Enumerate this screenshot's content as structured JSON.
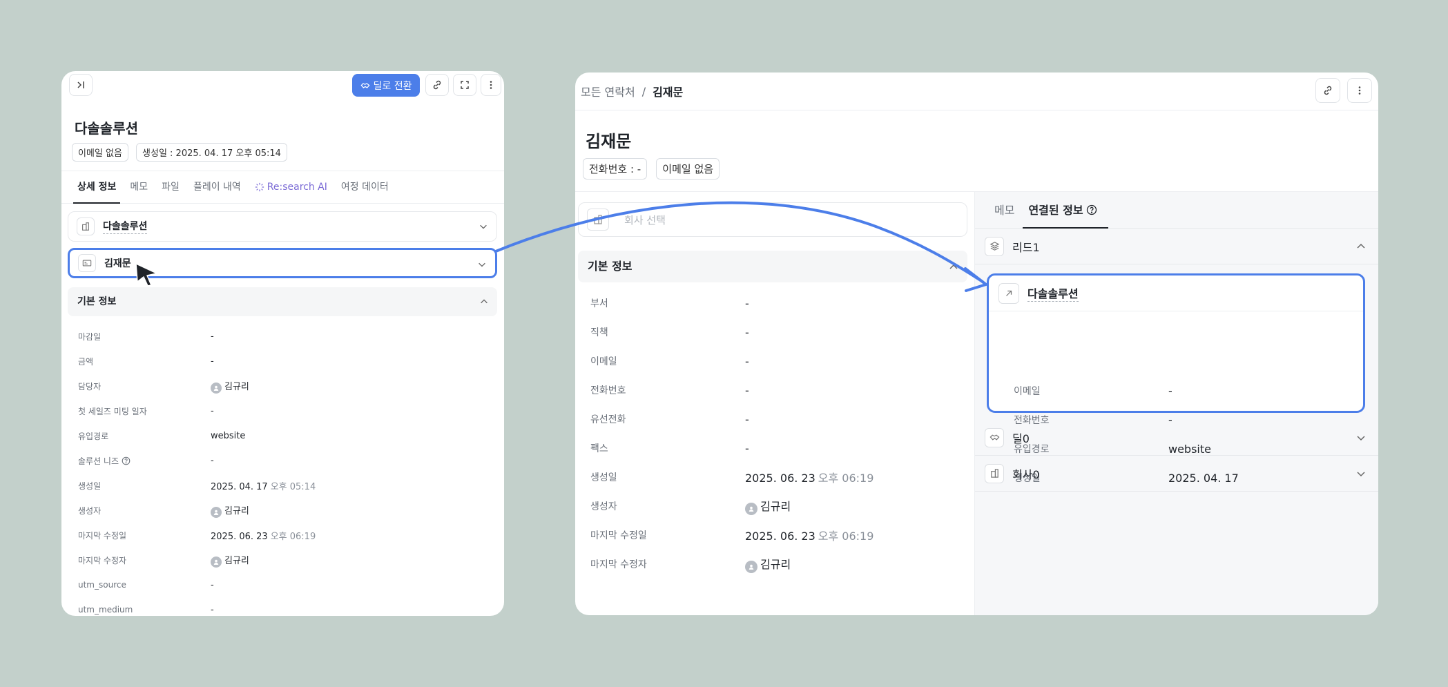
{
  "left_panel": {
    "convert_button": "딜로 전환",
    "title": "다솔솔루션",
    "chips": [
      "이메일 없음",
      "생성일 : 2025. 04. 17 오후 05:14"
    ],
    "tabs": [
      "상세 정보",
      "메모",
      "파일",
      "플레이 내역",
      "Re:search AI",
      "여정 데이터"
    ],
    "company_accordion": "다솔솔루션",
    "contact_accordion": "김재문",
    "section_title": "기본 정보",
    "rows": [
      {
        "key": "마감일",
        "value": "-"
      },
      {
        "key": "금액",
        "value": "-"
      },
      {
        "key": "담당자",
        "value": "김규리"
      },
      {
        "key": "첫 세일즈 미팅 일자",
        "value": "-"
      },
      {
        "key": "유입경로",
        "value": "website"
      },
      {
        "key": "솔루션 니즈",
        "value": "-"
      },
      {
        "key": "생성일",
        "value": "2025. 04. 17",
        "suffix": "오후 05:14"
      },
      {
        "key": "생성자",
        "value": "김규리"
      },
      {
        "key": "마지막 수정일",
        "value": "2025. 06. 23",
        "suffix": "오후 06:19"
      },
      {
        "key": "마지막 수정자",
        "value": "김규리"
      },
      {
        "key": "utm_source",
        "value": "-"
      },
      {
        "key": "utm_medium",
        "value": "-"
      }
    ]
  },
  "right_panel": {
    "breadcrumb_parent": "모든 연락처",
    "breadcrumb_sep": "/",
    "breadcrumb_current": "김재문",
    "title": "김재문",
    "chips": [
      "전화번호 : -",
      "이메일 없음"
    ],
    "company_placeholder": "회사 선택",
    "section_title": "기본 정보",
    "rows": [
      {
        "key": "부서",
        "value": "-"
      },
      {
        "key": "직책",
        "value": "-"
      },
      {
        "key": "이메일",
        "value": "-"
      },
      {
        "key": "전화번호",
        "value": "-"
      },
      {
        "key": "유선전화",
        "value": "-"
      },
      {
        "key": "팩스",
        "value": "-"
      },
      {
        "key": "생성일",
        "value": "2025. 06. 23",
        "suffix": "오후 06:19"
      },
      {
        "key": "생성자",
        "value": "김규리"
      },
      {
        "key": "마지막 수정일",
        "value": "2025. 06. 23",
        "suffix": "오후 06:19"
      },
      {
        "key": "마지막 수정자",
        "value": "김규리"
      }
    ],
    "side_tabs": [
      "메모",
      "연결된 정보"
    ],
    "lead_group": "리드1",
    "lead_card": {
      "name": "다솔솔루션",
      "rows": [
        {
          "key": "이메일",
          "value": "-"
        },
        {
          "key": "전화번호",
          "value": "-"
        },
        {
          "key": "유입경로",
          "value": "website"
        },
        {
          "key": "생성일",
          "value": "2025. 04. 17"
        }
      ]
    },
    "deal_group": "딜0",
    "company_group": "회사0"
  },
  "colors": {
    "accent": "#4c7ee9",
    "background": "#c3d0cb",
    "ai_purple": "#7b6bd6"
  }
}
